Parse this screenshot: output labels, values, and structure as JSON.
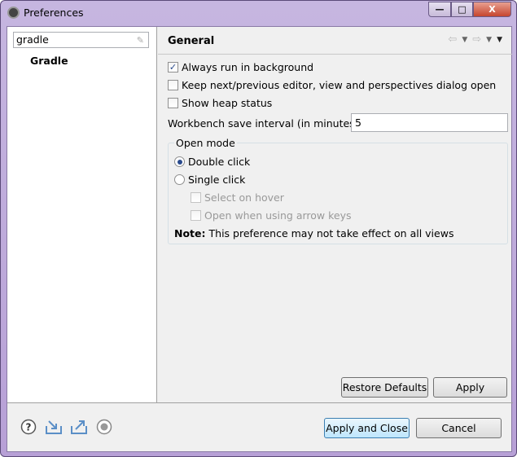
{
  "window": {
    "title": "Preferences"
  },
  "search": {
    "value": "gradle"
  },
  "tree": {
    "items": [
      {
        "label": "Gradle"
      }
    ]
  },
  "page": {
    "title": "General",
    "options": [
      {
        "label": "Always run in background",
        "checked": true
      },
      {
        "label": "Keep next/previous editor, view and perspectives dialog open",
        "checked": false
      },
      {
        "label": "Show heap status",
        "checked": false
      }
    ],
    "save_interval": {
      "label": "Workbench save interval (in minutes):",
      "value": "5"
    },
    "open_mode": {
      "legend": "Open mode",
      "double_click": {
        "label": "Double click",
        "selected": true
      },
      "single_click": {
        "label": "Single click",
        "selected": false
      },
      "select_on_hover": {
        "label": "Select on hover",
        "checked": false,
        "enabled": false
      },
      "open_arrow_keys": {
        "label": "Open when using arrow keys",
        "checked": false,
        "enabled": false
      },
      "note_label": "Note:",
      "note_text": "This preference may not take effect on all views"
    },
    "restore_defaults": "Restore Defaults",
    "apply": "Apply"
  },
  "footer": {
    "apply_and_close": "Apply and Close",
    "cancel": "Cancel",
    "icons": [
      "help-icon",
      "import-icon",
      "export-icon",
      "record-icon"
    ]
  }
}
